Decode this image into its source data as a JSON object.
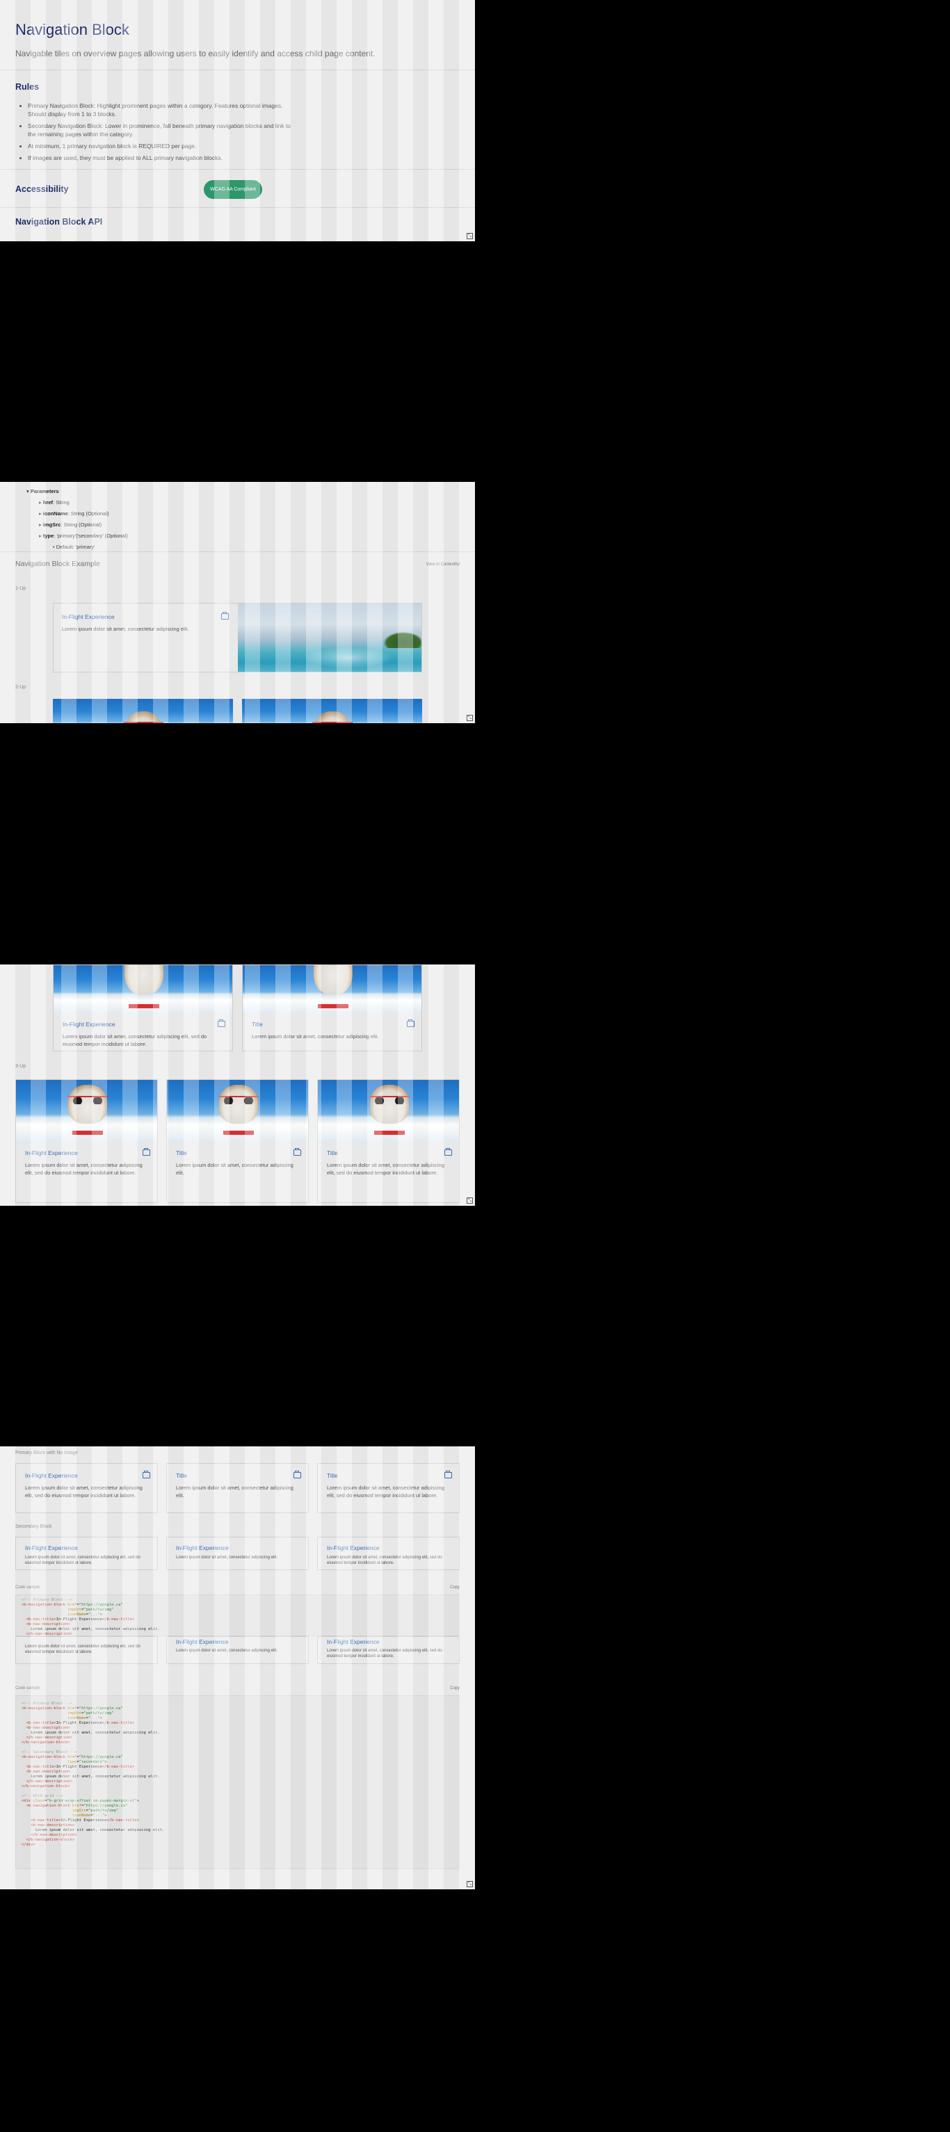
{
  "header": {
    "title": "Navigation Block",
    "subtitle": "Navigable tiles on overview pages allowing users to easily identify and access child page content."
  },
  "rules": {
    "heading": "Rules",
    "items": [
      "Primary Navigation Block: Highlight prominent pages within a category. Features optional images. Should display from 1 to 3 blocks.",
      "Secondary Navigation Block: Lower in prominence, fall beneath primary navigation blocks and link to the remaining pages within the category.",
      "At minimum, 1 primary navigation block is REQUIRED per page.",
      "If images are used, they must be applied to ALL primary navigation blocks."
    ]
  },
  "accessibility": {
    "heading": "Accessibility",
    "badge": "WCAG AA Compliant"
  },
  "api": {
    "heading": "Navigation Block API",
    "params_label": "Parameters",
    "params": [
      {
        "name": "href",
        "type": ": String"
      },
      {
        "name": "iconName",
        "type": ": String (Optional)"
      },
      {
        "name": "imgSrc",
        "type": ": String (Optional)"
      },
      {
        "name": "type",
        "type": ": 'primary'|'secondary' (Optional)"
      }
    ],
    "default": "Default: 'primary'"
  },
  "example": {
    "title": "Navigation Block Example",
    "link": "View in Contentful",
    "one_up": "1-Up",
    "two_up": "2-Up",
    "three_up": "3-Up",
    "no_image": "Primary Block with No Image",
    "secondary": "Secondary Block",
    "code_sample": "Code sample",
    "copy": "Copy"
  },
  "cards": {
    "inflight": "In-Flight Experience",
    "title": "Title",
    "short_desc": "Lorem ipsum dolor sit amet, consectetur adipiscing elit.",
    "long_desc": "Lorem ipsum dolor sit amet, consectetur adipiscing elit, sed do eiusmod tempor incididunt ut labore."
  },
  "code": {
    "comment_primary": "<!-- Primary Block -->",
    "comment_secondary": "<!-- Secondary Block -->",
    "comment_grid": "<!-- With grid -->"
  },
  "icons": [
    "folder-icon",
    "corner-icon"
  ]
}
